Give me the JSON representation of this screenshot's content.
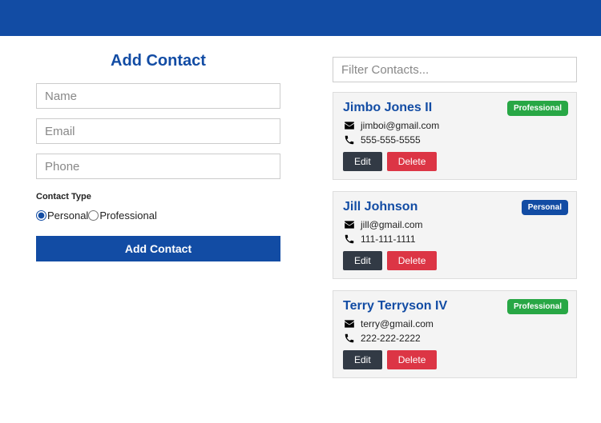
{
  "form": {
    "title": "Add Contact",
    "name_placeholder": "Name",
    "email_placeholder": "Email",
    "phone_placeholder": "Phone",
    "type_label": "Contact Type",
    "radio_personal": "Personal",
    "radio_professional": "Professional",
    "submit_label": "Add Contact"
  },
  "filter": {
    "placeholder": "Filter Contacts..."
  },
  "contacts": [
    {
      "name": "Jimbo Jones II",
      "email": "jimboi@gmail.com",
      "phone": "555-555-5555",
      "type": "Professional",
      "type_class": "pro"
    },
    {
      "name": "Jill Johnson",
      "email": "jill@gmail.com",
      "phone": "111-111-1111",
      "type": "Personal",
      "type_class": "per"
    },
    {
      "name": "Terry Terryson IV",
      "email": "terry@gmail.com",
      "phone": "222-222-2222",
      "type": "Professional",
      "type_class": "pro"
    }
  ],
  "actions": {
    "edit": "Edit",
    "delete": "Delete"
  }
}
